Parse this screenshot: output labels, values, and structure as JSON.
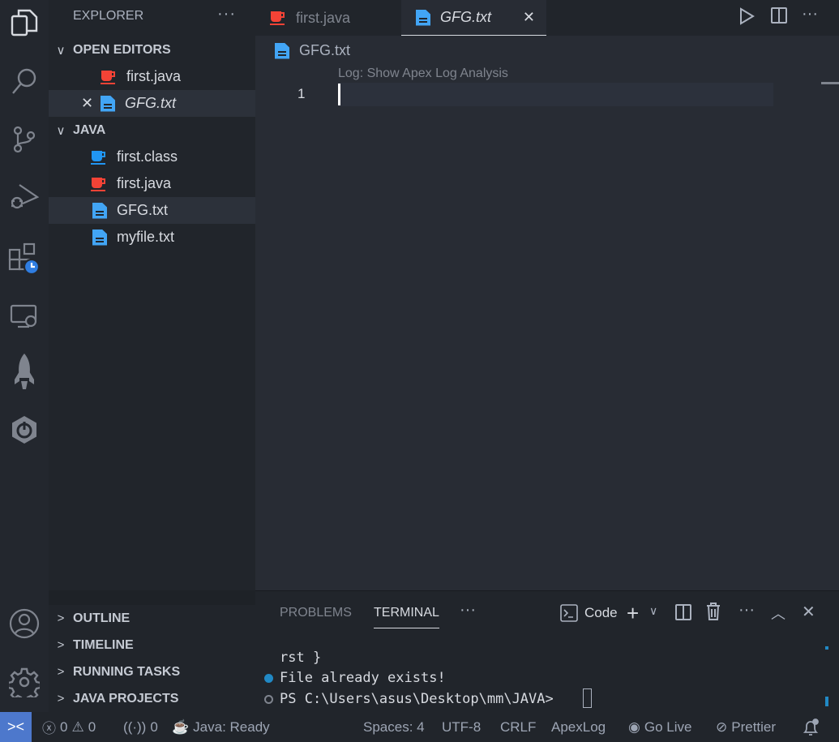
{
  "sidebar": {
    "title": "EXPLORER",
    "more": "···",
    "open_editors": {
      "label": "OPEN EDITORS",
      "items": [
        {
          "name": "first.java"
        },
        {
          "name": "GFG.txt"
        }
      ]
    },
    "folder": {
      "label": "JAVA",
      "items": [
        {
          "name": "first.class"
        },
        {
          "name": "first.java"
        },
        {
          "name": "GFG.txt"
        },
        {
          "name": "myfile.txt"
        }
      ]
    },
    "sections": [
      "OUTLINE",
      "TIMELINE",
      "RUNNING TASKS",
      "JAVA PROJECTS"
    ]
  },
  "tabs": [
    {
      "label": "first.java"
    },
    {
      "label": "GFG.txt"
    }
  ],
  "editor": {
    "breadcrumb": "GFG.txt",
    "codelens": "Log: Show Apex Log Analysis",
    "line_number": "1"
  },
  "panel": {
    "tabs": [
      "PROBLEMS",
      "TERMINAL"
    ],
    "active_tab": "TERMINAL",
    "more": "···",
    "shell": "Code",
    "lines": [
      "rst }",
      "File already exists!",
      "PS C:\\Users\\asus\\Desktop\\mm\\JAVA>"
    ]
  },
  "status": {
    "errors": "0",
    "warnings": "0",
    "ports": "0",
    "java": "Java: Ready",
    "spaces": "Spaces: 4",
    "encoding": "UTF-8",
    "eol": "CRLF",
    "apexlog": "ApexLog",
    "golive": "Go Live",
    "prettier": "Prettier"
  },
  "colors": {
    "java": "#f44336",
    "class": "#2196f3",
    "txt": "#42a5f5",
    "remote": "#4d78cc"
  }
}
